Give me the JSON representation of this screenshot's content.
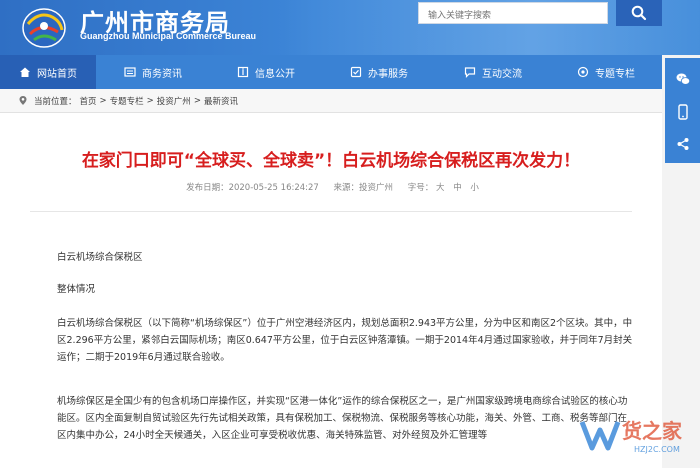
{
  "header": {
    "title": "广州市商务局",
    "subtitle": "Guangzhou Municipal Commerce Bureau",
    "search_placeholder": "输入关键字搜索"
  },
  "nav": [
    {
      "label": "网站首页",
      "icon": "home-icon"
    },
    {
      "label": "商务资讯",
      "icon": "news-icon"
    },
    {
      "label": "信息公开",
      "icon": "info-icon"
    },
    {
      "label": "办事服务",
      "icon": "service-icon"
    },
    {
      "label": "互动交流",
      "icon": "chat-icon"
    },
    {
      "label": "专题专栏",
      "icon": "topic-icon"
    }
  ],
  "breadcrumb": {
    "prefix": "当前位置：",
    "items": [
      "首页",
      "专题专栏",
      "投资广州",
      "最新资讯"
    ],
    "separator": ">"
  },
  "article": {
    "title": "在家门口即可“全球买、全球卖”！白云机场综合保税区再次发力！",
    "date": "发布日期：2020-05-25 16:24:27",
    "source": "来源：投资广州",
    "font_label": "字号：",
    "font_sizes": [
      "大",
      "中",
      "小"
    ],
    "paragraphs": [
      "白云机场综合保税区",
      "整体情况",
      "白云机场综合保税区（以下简称“机场综保区”）位于广州空港经济区内，规划总面积2.943平方公里，分为中区和南区2个区块。其中，中区2.296平方公里，紧邻白云国际机场；南区0.647平方公里，位于白云区钟落潭镇。一期于2014年4月通过国家验收，并于同年7月封关运作；二期于2019年6月通过联合验收。",
      "机场综保区是全国少有的包含机场口岸操作区，并实现“区港一体化”运作的综合保税区之一，是广州国家级跨境电商综合试验区的核心功能区。区内全面复制自贸试验区先行先试相关政策，具有保税加工、保税物流、保税服务等核心功能，海关、外管、工商、税务等部门在区内集中办公，24小时全天候通关，入区企业可享受税收优惠、海关特殊监管、对外经贸及外汇管理等"
    ]
  },
  "watermark": {
    "text": "货之家",
    "sub": "HZJ2C.COM"
  },
  "colors": {
    "header_blue": "#3d86d8",
    "nav_active": "#2860b5",
    "title_red": "#d71e1e"
  }
}
